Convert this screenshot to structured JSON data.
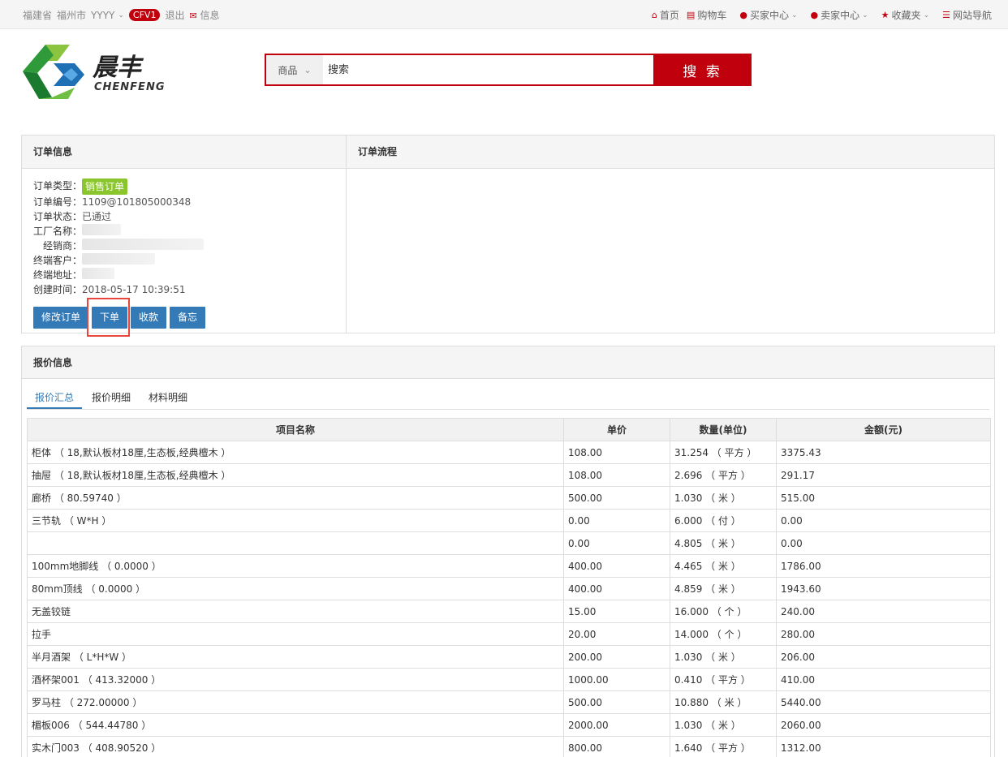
{
  "topbar": {
    "province": "福建省",
    "city": "福州市",
    "user": "YYYY",
    "badge": "CFV1",
    "logout": "退出",
    "messages": "信息",
    "home": "首页",
    "cart": "购物车",
    "buyer_center": "买家中心",
    "seller_center": "卖家中心",
    "favorites": "收藏夹",
    "site_nav": "网站导航"
  },
  "header": {
    "logo_cn": "晨丰",
    "logo_en": "CHENFENG",
    "search_category": "商品",
    "search_placeholder": "搜索",
    "search_button": "搜 索"
  },
  "order_info": {
    "title": "订单信息",
    "type_label": "订单类型：",
    "type_value": "销售订单",
    "no_label": "订单编号：",
    "no_value": "1109@101805000348",
    "status_label": "订单状态：",
    "status_value": "已通过",
    "factory_label": "工厂名称：",
    "dealer_label": "经销商：",
    "customer_label": "终端客户：",
    "address_label": "终端地址：",
    "created_label": "创建时间：",
    "created_value": "2018-05-17 10:39:51",
    "buttons": [
      "修改订单",
      "下单",
      "收款",
      "备忘"
    ]
  },
  "order_flow": {
    "title": "订单流程"
  },
  "quote": {
    "title": "报价信息",
    "tabs": [
      "报价汇总",
      "报价明细",
      "材料明细"
    ],
    "columns": [
      "项目名称",
      "单价",
      "数量(单位)",
      "金额(元)"
    ],
    "rows": [
      [
        "柜体 （ 18,默认板材18厘,生态板,经典檀木 ）",
        "108.00",
        "31.254 （ 平方 ）",
        "3375.43"
      ],
      [
        "抽屉 （ 18,默认板材18厘,生态板,经典檀木 ）",
        "108.00",
        "2.696 （ 平方 ）",
        "291.17"
      ],
      [
        "廊桥 （ 80.59740 ）",
        "500.00",
        "1.030 （ 米 ）",
        "515.00"
      ],
      [
        "三节轨 （ W*H ）",
        "0.00",
        "6.000 （ 付 ）",
        "0.00"
      ],
      [
        "",
        "0.00",
        "4.805 （ 米 ）",
        "0.00"
      ],
      [
        "100mm地脚线 （ 0.0000 ）",
        "400.00",
        "4.465 （ 米 ）",
        "1786.00"
      ],
      [
        "80mm顶线 （ 0.0000 ）",
        "400.00",
        "4.859 （ 米 ）",
        "1943.60"
      ],
      [
        "无盖铰链",
        "15.00",
        "16.000 （ 个 ）",
        "240.00"
      ],
      [
        "拉手",
        "20.00",
        "14.000 （ 个 ）",
        "280.00"
      ],
      [
        "半月酒架 （ L*H*W ）",
        "200.00",
        "1.030 （ 米 ）",
        "206.00"
      ],
      [
        "酒杯架001 （ 413.32000 ）",
        "1000.00",
        "0.410 （ 平方 ）",
        "410.00"
      ],
      [
        "罗马柱 （ 272.00000 ）",
        "500.00",
        "10.880 （ 米 ）",
        "5440.00"
      ],
      [
        "楣板006 （ 544.44780 ）",
        "2000.00",
        "1.030 （ 米 ）",
        "2060.00"
      ],
      [
        "实木门003 （ 408.90520 ）",
        "800.00",
        "1.640 （ 平方 ）",
        "1312.00"
      ]
    ]
  },
  "colors": {
    "brand_red": "#c1000d",
    "primary_blue": "#337ab7",
    "tag_green": "#8ac52d"
  }
}
